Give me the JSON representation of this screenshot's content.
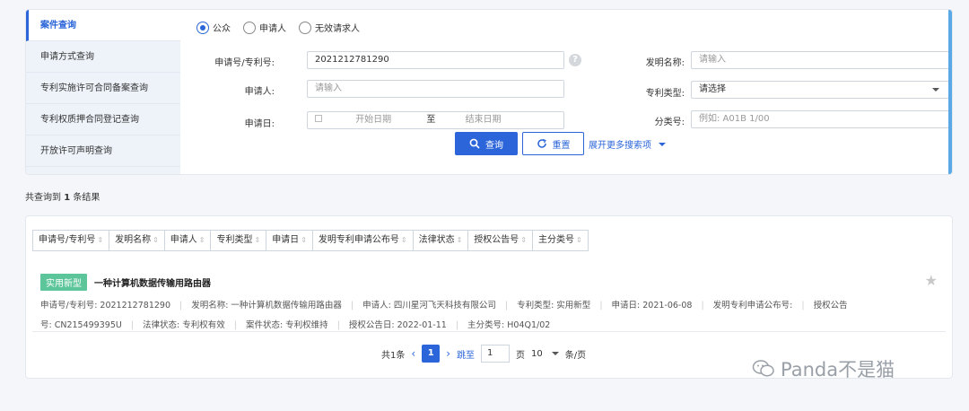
{
  "sidebar": {
    "items": [
      {
        "label": "案件查询"
      },
      {
        "label": "申请方式查询"
      },
      {
        "label": "专利实施许可合同备案查询"
      },
      {
        "label": "专利权质押合同登记查询"
      },
      {
        "label": "开放许可声明查询"
      }
    ]
  },
  "search": {
    "radios": [
      "公众",
      "申请人",
      "无效请求人"
    ],
    "selected_radio": "公众",
    "app_no_label": "申请号/专利号:",
    "app_no_value": "2021212781290",
    "help_icon_text": "?",
    "invention_name_label": "发明名称:",
    "invention_name_placeholder": "请输入",
    "applicant_label": "申请人:",
    "applicant_placeholder": "请输入",
    "patent_type_label": "专利类型:",
    "patent_type_value": "请选择",
    "app_date_label": "申请日:",
    "start_date_placeholder": "开始日期",
    "date_to": "至",
    "end_date_placeholder": "结束日期",
    "class_no_label": "分类号:",
    "class_no_placeholder": "例如: A01B 1/00",
    "search_button": "查询",
    "reset_button": "重置",
    "more_link": "展开更多搜索项"
  },
  "result_summary": {
    "prefix": "共查询到",
    "count": "1",
    "suffix": "条结果"
  },
  "sort_fields": [
    "申请号/专利号",
    "发明名称",
    "申请人",
    "专利类型",
    "申请日",
    "发明专利申请公布号",
    "法律状态",
    "授权公告号",
    "主分类号"
  ],
  "record": {
    "badge": "实用新型",
    "title": "一种计算机数据传输用路由器",
    "meta_line1": [
      "申请号/专利号: 2021212781290",
      "发明名称: 一种计算机数据传输用路由器",
      "申请人: 四川星河飞天科技有限公司",
      "专利类型: 实用新型",
      "申请日: 2021-06-08",
      "发明专利申请公布号:",
      "授权公告"
    ],
    "meta_line2": [
      "号: CN215499395U",
      "法律状态: 专利权有效",
      "案件状态: 专利权维持",
      "授权公告日: 2022-01-11",
      "主分类号: H04Q1/02"
    ]
  },
  "pager": {
    "total": "共1条",
    "current_page": "1",
    "jump_label": "跳至",
    "jump_value": "1",
    "page_unit": "页",
    "page_size": "10",
    "size_unit": "条/页"
  },
  "watermark": {
    "text": "Panda不是猫"
  },
  "colors": {
    "accent": "#2b65d9",
    "badge": "#5cc59a"
  }
}
